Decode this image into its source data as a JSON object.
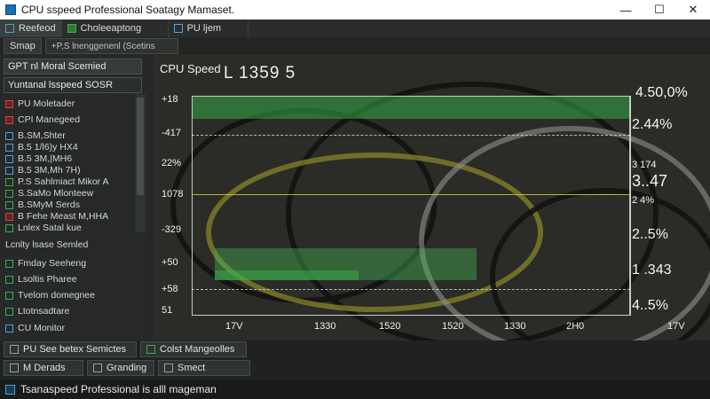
{
  "window": {
    "title": "CPU sspeed Professional Soatagy Mamaset.",
    "controls": [
      "—",
      "☐",
      "✕"
    ]
  },
  "tabs": [
    {
      "label": "Reefeod"
    },
    {
      "label": "Choleeaptong"
    },
    {
      "label": "PU ljem"
    }
  ],
  "toolbar": {
    "button_label": "Smap",
    "select_value": "+P,S lnenggenenl (Scetins"
  },
  "sidebar": {
    "headers": [
      "GPT nl Moral Scemied",
      "Yuntanal lsspeed  SOSR"
    ],
    "items": [
      {
        "label": "PU Moletader",
        "icon": "red-square-icon"
      },
      {
        "label": "CPI Manegeed",
        "icon": "red-square-icon"
      },
      {
        "label": "B.SM,Shter",
        "icon": "blue-square-icon"
      },
      {
        "label": "B.5 1/l6)y HX4",
        "icon": "blue-square-icon"
      },
      {
        "label": "B.5  3M,|MH6",
        "icon": "blue-square-icon"
      },
      {
        "label": "B.5 3M,Mh 7H)",
        "icon": "blue-square-icon"
      },
      {
        "label": "P.S  Sahlmiact Mikor A",
        "icon": "green-square-icon"
      },
      {
        "label": "S.SaMo Mlonteew",
        "icon": "green-square-icon"
      },
      {
        "label": "B.SMyM Serds",
        "icon": "green-square-icon"
      },
      {
        "label": "B Fehe Meast M,HHA",
        "icon": "green-square-icon"
      },
      {
        "label": "Lnlex Satal kue",
        "icon": "green-square-icon"
      },
      {
        "label": "Lcnlty lsase Semled",
        "icon": "none"
      },
      {
        "label": "Fmday Seeheng",
        "icon": "green-square-icon"
      },
      {
        "label": "Lsoltis Pharee",
        "icon": "green-square-icon"
      },
      {
        "label": "Tvelom domegnee",
        "icon": "green-square-icon"
      },
      {
        "label": "Ltotnsadtare",
        "icon": "green-square-icon"
      },
      {
        "label": "CU Monitor",
        "icon": "blue-square-icon"
      }
    ]
  },
  "chart": {
    "title": "CPU Speed",
    "current_value": "L 1359 5",
    "y_ticks": [
      "+18",
      "-417",
      "22%",
      "1078",
      "-329",
      "+50",
      "+58",
      "51"
    ],
    "x_ticks": [
      "17V",
      "1330",
      "1520",
      "1520",
      "1330",
      "2H0",
      "17V"
    ],
    "right_labels": [
      "4.50,0%",
      "2.44%",
      "3  174",
      "3..47",
      "2  4%",
      "2..5%",
      "1  .343",
      "4..5%"
    ]
  },
  "chart_data": {
    "type": "area",
    "title": "CPU Speed",
    "series": [
      {
        "values": [
          0.93,
          0.93,
          0.95,
          0.95,
          0.93,
          0.94,
          0.93
        ]
      },
      {
        "values": [
          0.2,
          0.2,
          0.55,
          0.55,
          0.55,
          0.2,
          0.2
        ]
      }
    ],
    "grid": true,
    "legend": "none"
  },
  "bottom": {
    "row1": [
      {
        "label": "PU See betex Semictes"
      },
      {
        "label": "Colst Mangeolles"
      }
    ],
    "row2": [
      {
        "label": "M Derads"
      },
      {
        "label": "Granding"
      },
      {
        "label": "Smect"
      }
    ]
  },
  "status": {
    "text": "Tsanaspeed Professional is alll mageman"
  },
  "colors": {
    "accent_green": "#3fae4a",
    "accent_blue": "#4da3d8",
    "background": "#222524"
  }
}
